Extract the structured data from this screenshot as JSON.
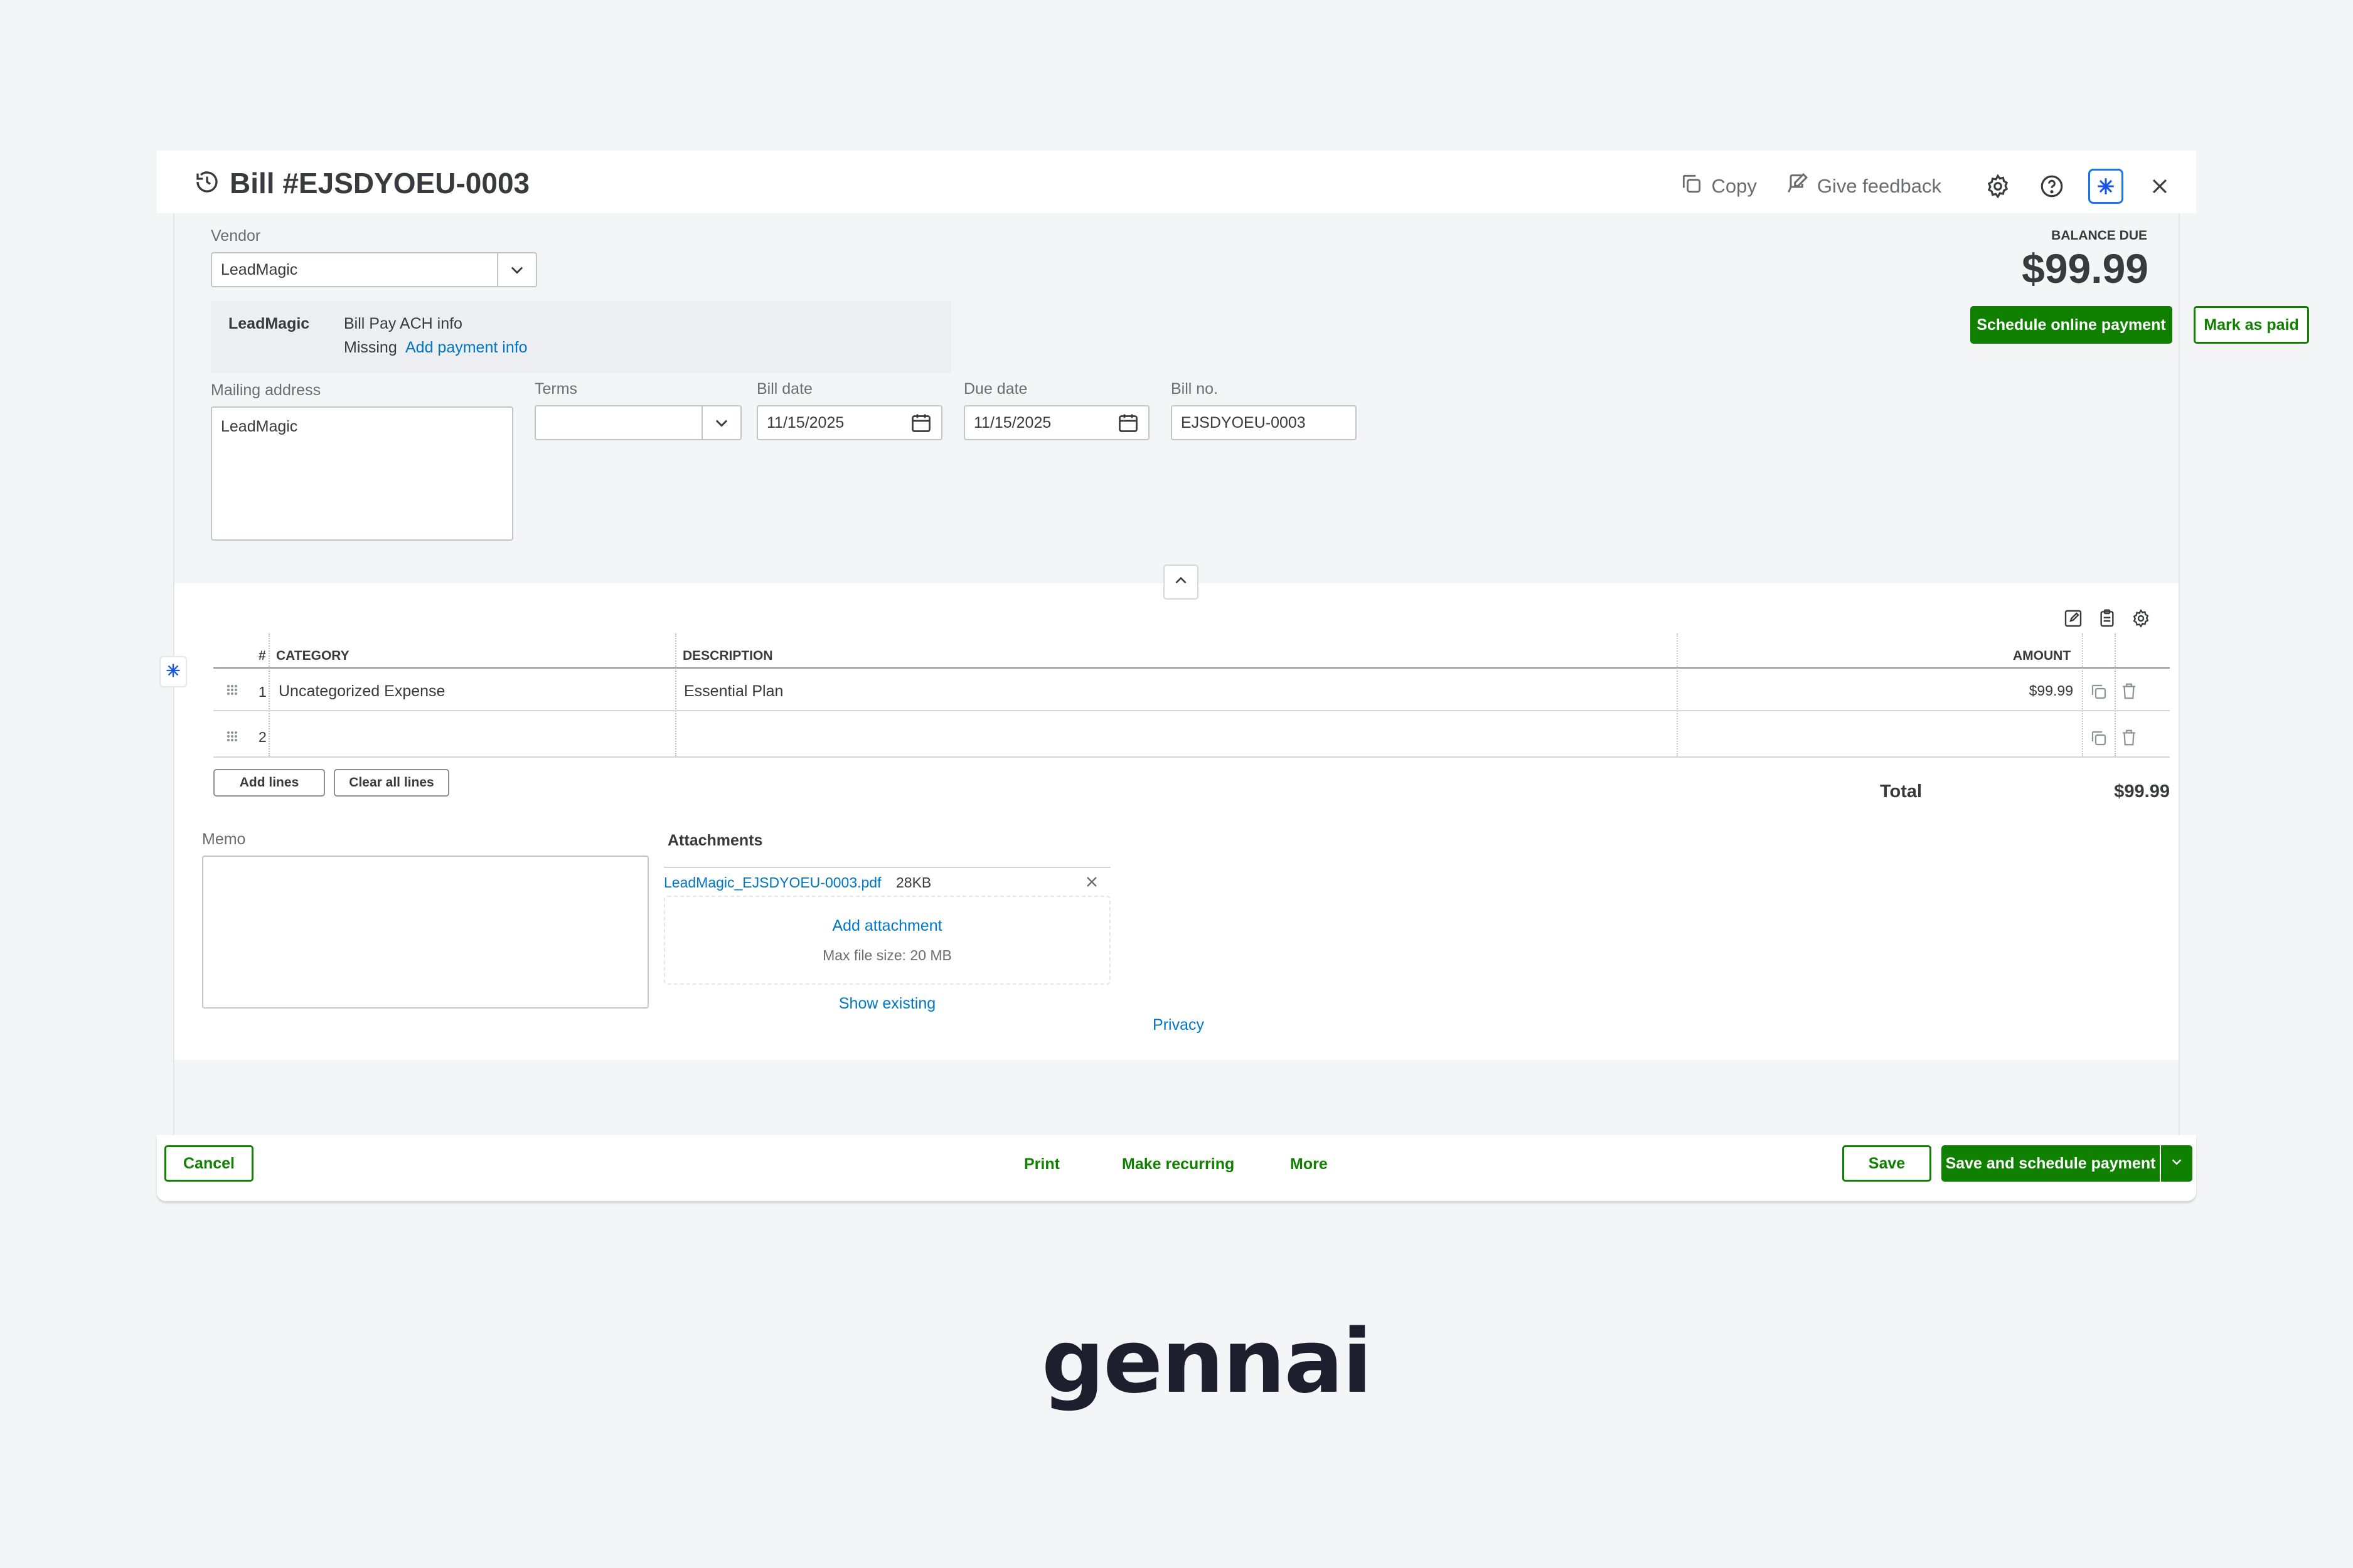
{
  "header": {
    "title": "Bill #EJSDYOEU-0003",
    "copy_label": "Copy",
    "feedback_label": "Give feedback"
  },
  "vendor": {
    "label": "Vendor",
    "value": "LeadMagic",
    "info_name": "LeadMagic",
    "info_title": "Bill Pay ACH info",
    "info_status": "Missing",
    "info_link": "Add payment info"
  },
  "balance": {
    "label": "BALANCE DUE",
    "amount": "$99.99",
    "schedule_label": "Schedule online payment",
    "mark_paid_label": "Mark as paid"
  },
  "fields": {
    "mailing_label": "Mailing address",
    "mailing_value": "LeadMagic",
    "terms_label": "Terms",
    "terms_value": "",
    "bill_date_label": "Bill date",
    "bill_date_value": "11/15/2025",
    "due_date_label": "Due date",
    "due_date_value": "11/15/2025",
    "bill_no_label": "Bill no.",
    "bill_no_value": "EJSDYOEU-0003"
  },
  "table": {
    "headers": {
      "num": "#",
      "category": "CATEGORY",
      "description": "DESCRIPTION",
      "amount": "AMOUNT"
    },
    "rows": [
      {
        "num": "1",
        "category": "Uncategorized Expense",
        "description": "Essential Plan",
        "amount": "$99.99"
      },
      {
        "num": "2",
        "category": "",
        "description": "",
        "amount": ""
      }
    ],
    "add_lines_label": "Add lines",
    "clear_lines_label": "Clear all lines",
    "total_label": "Total",
    "total_value": "$99.99"
  },
  "memo": {
    "label": "Memo",
    "value": ""
  },
  "attachments": {
    "label": "Attachments",
    "file_name": "LeadMagic_EJSDYOEU-0003.pdf",
    "file_size": "28KB",
    "add_label": "Add attachment",
    "max_size": "Max file size: 20 MB",
    "show_existing": "Show existing"
  },
  "privacy_label": "Privacy",
  "footer": {
    "cancel_label": "Cancel",
    "print_label": "Print",
    "recurring_label": "Make recurring",
    "more_label": "More",
    "save_label": "Save",
    "save_schedule_label": "Save and schedule payment"
  },
  "brand": "gennai",
  "colors": {
    "green": "#108000",
    "link": "#0077c5",
    "ai_blue": "#1a73e8"
  }
}
